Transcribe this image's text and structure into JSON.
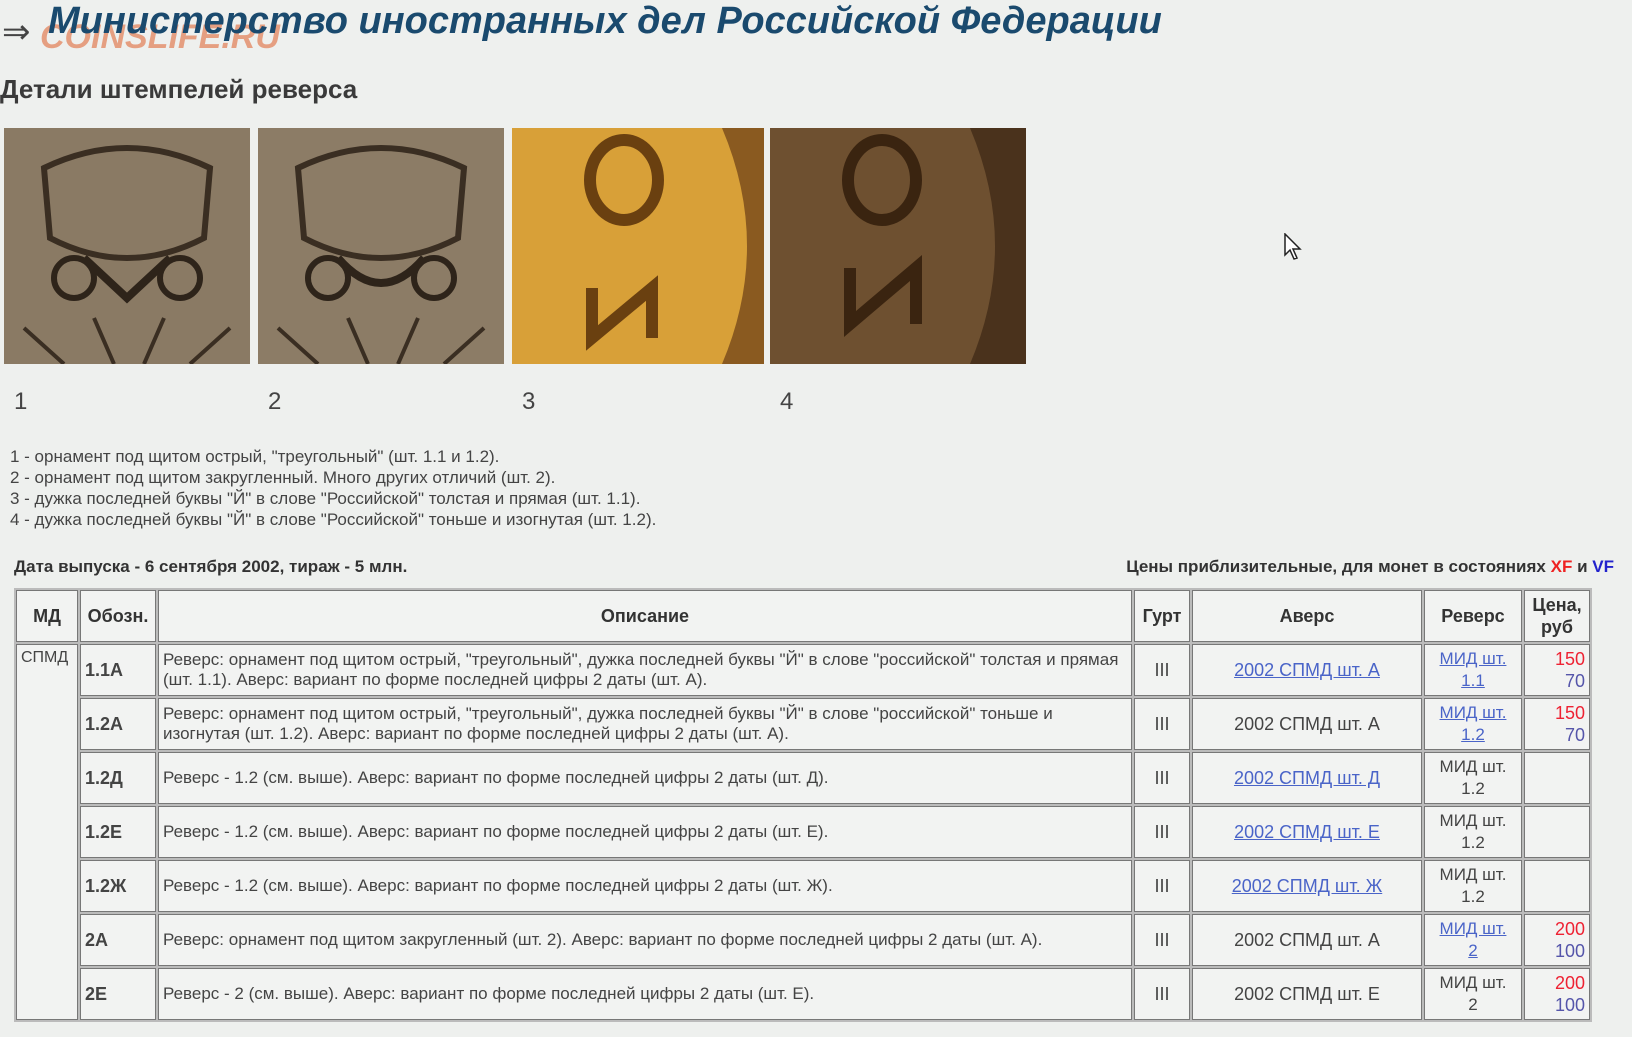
{
  "header": {
    "arrow": "⇒",
    "watermark": "COINSLIFE.RU",
    "title": "Министерство иностранных дел Российской Федерации"
  },
  "section_title": "Детали штемпелей реверса",
  "photos": [
    {
      "caption": "1",
      "tone": "#8a7a64"
    },
    {
      "caption": "2",
      "tone": "#8c7c66"
    },
    {
      "caption": "3",
      "tone": "#d8a038"
    },
    {
      "caption": "4",
      "tone": "#6e5030"
    }
  ],
  "notes": [
    "1 - орнамент под щитом острый, \"треугольный\" (шт. 1.1 и 1.2).",
    "2 - орнамент под щитом закругленный. Много других отличий (шт. 2).",
    "3 - дужка последней буквы \"Й\" в слове \"Российской\" толстая и прямая (шт. 1.1).",
    "4 - дужка последней буквы \"Й\" в слове \"Российской\" тоньше и изогнутая (шт. 1.2)."
  ],
  "info": {
    "left": "Дата выпуска - 6 сентября 2002, тираж - 5 млн.",
    "right_prefix": "Цены приблизительные, для монет в состояниях",
    "xf": "XF",
    "and": "и",
    "vf": "VF"
  },
  "table": {
    "headers": {
      "md": "МД",
      "code": "Обозн.",
      "desc": "Описание",
      "edge": "Гурт",
      "obverse": "Аверс",
      "reverse": "Реверс",
      "price": "Цена, руб"
    },
    "md_value": "СПМД",
    "rows": [
      {
        "code": "1.1А",
        "desc": "Реверс: орнамент под щитом острый, \"треугольный\", дужка последней буквы \"Й\" в слове \"российской\" толстая и прямая (шт. 1.1). Аверс: вариант по форме последней цифры 2 даты (шт. А).",
        "edge": "III",
        "obverse": "2002 СПМД шт. А",
        "obverse_link": true,
        "rev1": "МИД шт.",
        "rev2": "1.1",
        "rev_link": true,
        "xf": "150",
        "vf": "70"
      },
      {
        "code": "1.2А",
        "desc": "Реверс: орнамент под щитом острый, \"треугольный\", дужка последней буквы \"Й\" в слове \"российской\" тоньше и изогнутая (шт. 1.2). Аверс: вариант по форме последней цифры 2 даты (шт. А).",
        "edge": "III",
        "obverse": "2002 СПМД шт. А",
        "obverse_link": false,
        "rev1": "МИД шт.",
        "rev2": "1.2",
        "rev_link": true,
        "xf": "150",
        "vf": "70"
      },
      {
        "code": "1.2Д",
        "desc": "Реверс - 1.2 (см. выше). Аверс: вариант по форме последней цифры 2 даты (шт. Д).",
        "edge": "III",
        "obverse": "2002 СПМД шт. Д",
        "obverse_link": true,
        "rev1": "МИД шт.",
        "rev2": "1.2",
        "rev_link": false,
        "xf": "",
        "vf": ""
      },
      {
        "code": "1.2Е",
        "desc": "Реверс - 1.2 (см. выше). Аверс: вариант по форме последней цифры 2 даты (шт. Е).",
        "edge": "III",
        "obverse": "2002 СПМД шт. Е",
        "obverse_link": true,
        "rev1": "МИД шт.",
        "rev2": "1.2",
        "rev_link": false,
        "xf": "",
        "vf": ""
      },
      {
        "code": "1.2Ж",
        "desc": "Реверс - 1.2 (см. выше). Аверс: вариант по форме последней цифры 2 даты (шт. Ж).",
        "edge": "III",
        "obverse": "2002 СПМД шт. Ж",
        "obverse_link": true,
        "rev1": "МИД шт.",
        "rev2": "1.2",
        "rev_link": false,
        "xf": "",
        "vf": ""
      },
      {
        "code": "2А",
        "desc": "Реверс: орнамент под щитом закругленный (шт. 2). Аверс: вариант по форме последней цифры 2 даты (шт. А).",
        "edge": "III",
        "obverse": "2002 СПМД шт. А",
        "obverse_link": false,
        "rev1": "МИД шт.",
        "rev2": "2",
        "rev_link": true,
        "xf": "200",
        "vf": "100"
      },
      {
        "code": "2Е",
        "desc": "Реверс - 2 (см. выше). Аверс: вариант по форме последней цифры 2 даты (шт. Е).",
        "edge": "III",
        "obverse": "2002 СПМД шт. Е",
        "obverse_link": false,
        "rev1": "МИД шт.",
        "rev2": "2",
        "rev_link": false,
        "xf": "200",
        "vf": "100"
      }
    ]
  }
}
